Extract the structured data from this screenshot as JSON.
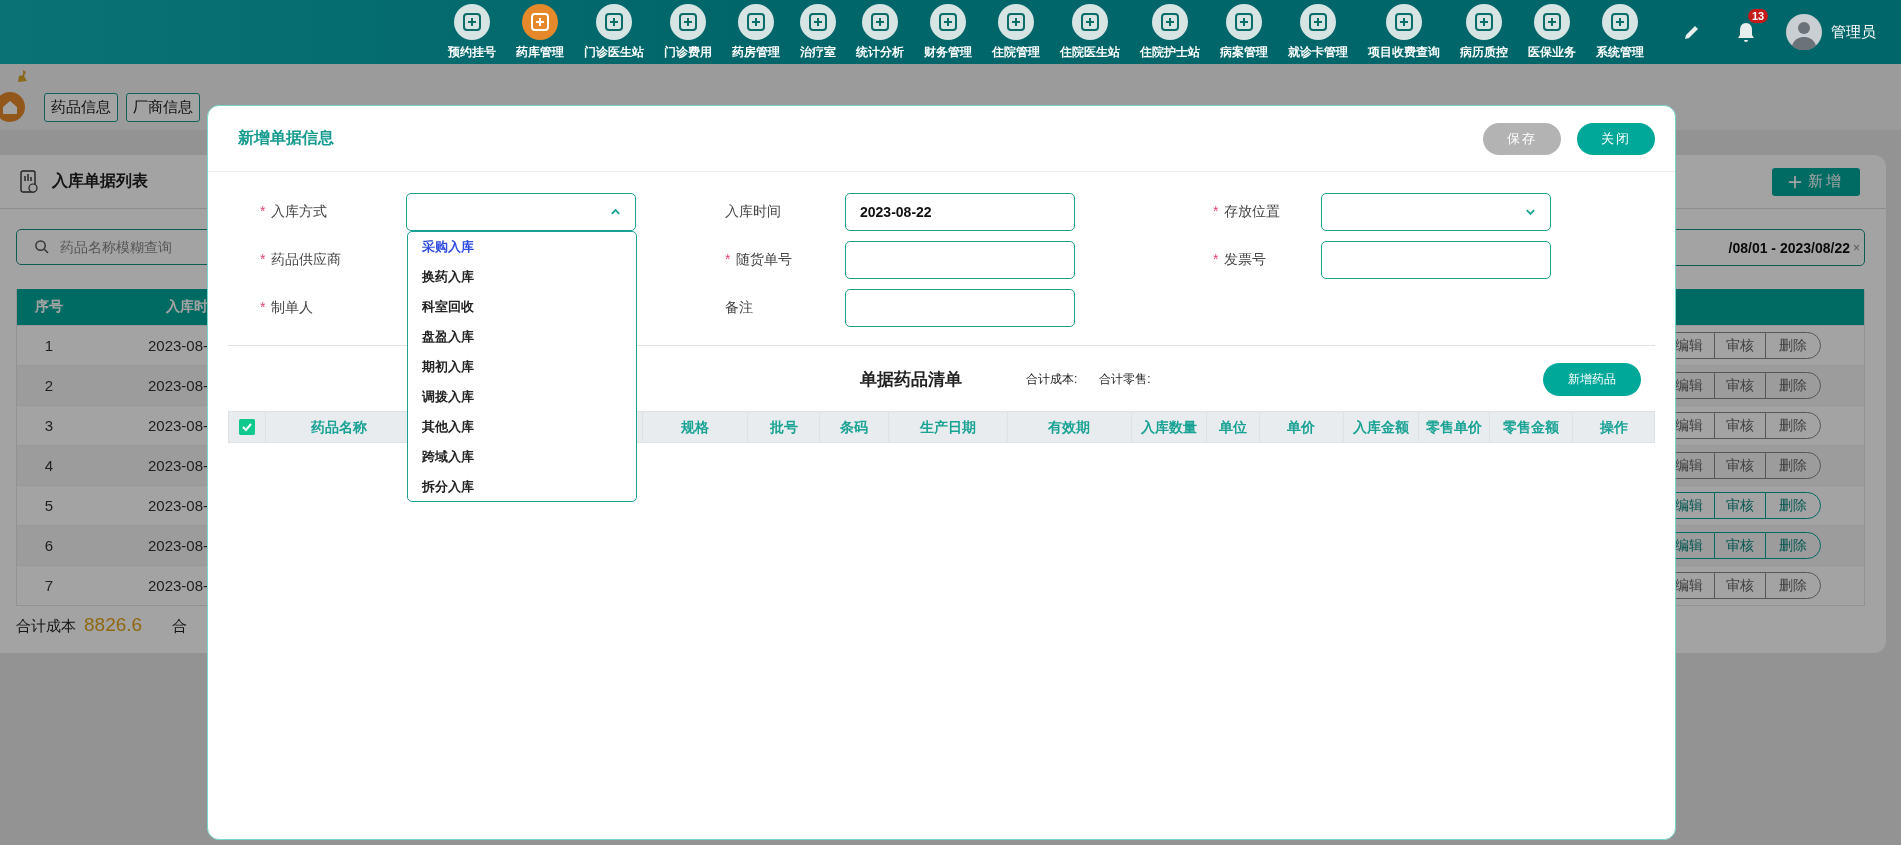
{
  "topbar": {
    "nav": [
      {
        "label": "预约挂号",
        "selected": false
      },
      {
        "label": "药库管理",
        "selected": true
      },
      {
        "label": "门诊医生站",
        "selected": false
      },
      {
        "label": "门诊费用",
        "selected": false
      },
      {
        "label": "药房管理",
        "selected": false
      },
      {
        "label": "治疗室",
        "selected": false
      },
      {
        "label": "统计分析",
        "selected": false
      },
      {
        "label": "财务管理",
        "selected": false
      },
      {
        "label": "住院管理",
        "selected": false
      },
      {
        "label": "住院医生站",
        "selected": false
      },
      {
        "label": "住院护士站",
        "selected": false
      },
      {
        "label": "病案管理",
        "selected": false
      },
      {
        "label": "就诊卡管理",
        "selected": false
      },
      {
        "label": "项目收费查询",
        "selected": false
      },
      {
        "label": "病历质控",
        "selected": false
      },
      {
        "label": "医保业务",
        "selected": false
      },
      {
        "label": "系统管理",
        "selected": false
      }
    ],
    "notifications": "13",
    "user": "管理员"
  },
  "tabs": [
    {
      "label": "药品信息"
    },
    {
      "label": "厂商信息"
    }
  ],
  "list": {
    "title": "入库单据列表",
    "add_button": "新增",
    "search": {
      "placeholder": "药品名称模糊查询"
    },
    "date_range": "/08/01 - 2023/08/22",
    "clear": "×",
    "columns": [
      "序号",
      "入库时"
    ],
    "rows": [
      {
        "no": "1",
        "time": "2023-08-",
        "disabled": true,
        "actions": [
          "编辑",
          "审核",
          "删除"
        ]
      },
      {
        "no": "2",
        "time": "2023-08-",
        "disabled": true,
        "actions": [
          "编辑",
          "审核",
          "删除"
        ]
      },
      {
        "no": "3",
        "time": "2023-08-",
        "disabled": true,
        "actions": [
          "编辑",
          "审核",
          "删除"
        ]
      },
      {
        "no": "4",
        "time": "2023-08-",
        "disabled": true,
        "actions": [
          "编辑",
          "审核",
          "删除"
        ]
      },
      {
        "no": "5",
        "time": "2023-08-",
        "disabled": false,
        "actions": [
          "编辑",
          "审核",
          "删除"
        ]
      },
      {
        "no": "6",
        "time": "2023-08-",
        "disabled": false,
        "actions": [
          "编辑",
          "审核",
          "删除"
        ]
      },
      {
        "no": "7",
        "time": "2023-08-",
        "disabled": true,
        "actions": [
          "编辑",
          "审核",
          "删除"
        ]
      }
    ],
    "footer": {
      "cost_label": "合计成本",
      "cost": "8826.6",
      "retail_label": "合"
    }
  },
  "dialog": {
    "title": "新增单据信息",
    "buttons": [
      {
        "label": "保存",
        "kind": "secondary"
      },
      {
        "label": "关闭",
        "kind": "primary"
      }
    ],
    "fields": [
      {
        "label": "入库方式",
        "required_mark": "*",
        "kind": "select",
        "expanded": true
      },
      {
        "label": "入库时间",
        "kind": "text",
        "value": "2023-08-22"
      },
      {
        "label": "存放位置",
        "required_mark": "*",
        "kind": "select",
        "expanded": false
      },
      {
        "label": "药品供应商",
        "required_mark": "*"
      },
      {
        "label": "随货单号",
        "required_mark": "*",
        "kind": "text"
      },
      {
        "label": "发票号",
        "required_mark": "*",
        "kind": "text"
      },
      {
        "label": "制单人",
        "required_mark": "*"
      },
      {
        "label": "备注",
        "kind": "text"
      }
    ],
    "options": [
      {
        "label": "采购入库",
        "selected": true
      },
      {
        "label": "换药入库",
        "selected": false
      },
      {
        "label": "科室回收",
        "selected": false
      },
      {
        "label": "盘盈入库",
        "selected": false
      },
      {
        "label": "期初入库",
        "selected": false
      },
      {
        "label": "调拨入库",
        "selected": false
      },
      {
        "label": "其他入库",
        "selected": false
      },
      {
        "label": "跨域入库",
        "selected": false
      },
      {
        "label": "拆分入库",
        "selected": false
      }
    ],
    "section_title": "单据药品清单",
    "cost_label": "合计成本:",
    "retail_label": "合计零售:",
    "add_drug_button": "新增药品",
    "select_all": {
      "checked": true
    },
    "columns": [
      "药品名称",
      "规格",
      "批号",
      "条码",
      "生产日期",
      "有效期",
      "入库数量",
      "单位",
      "单价",
      "入库金额",
      "零售单价",
      "零售金额",
      "操作"
    ]
  }
}
